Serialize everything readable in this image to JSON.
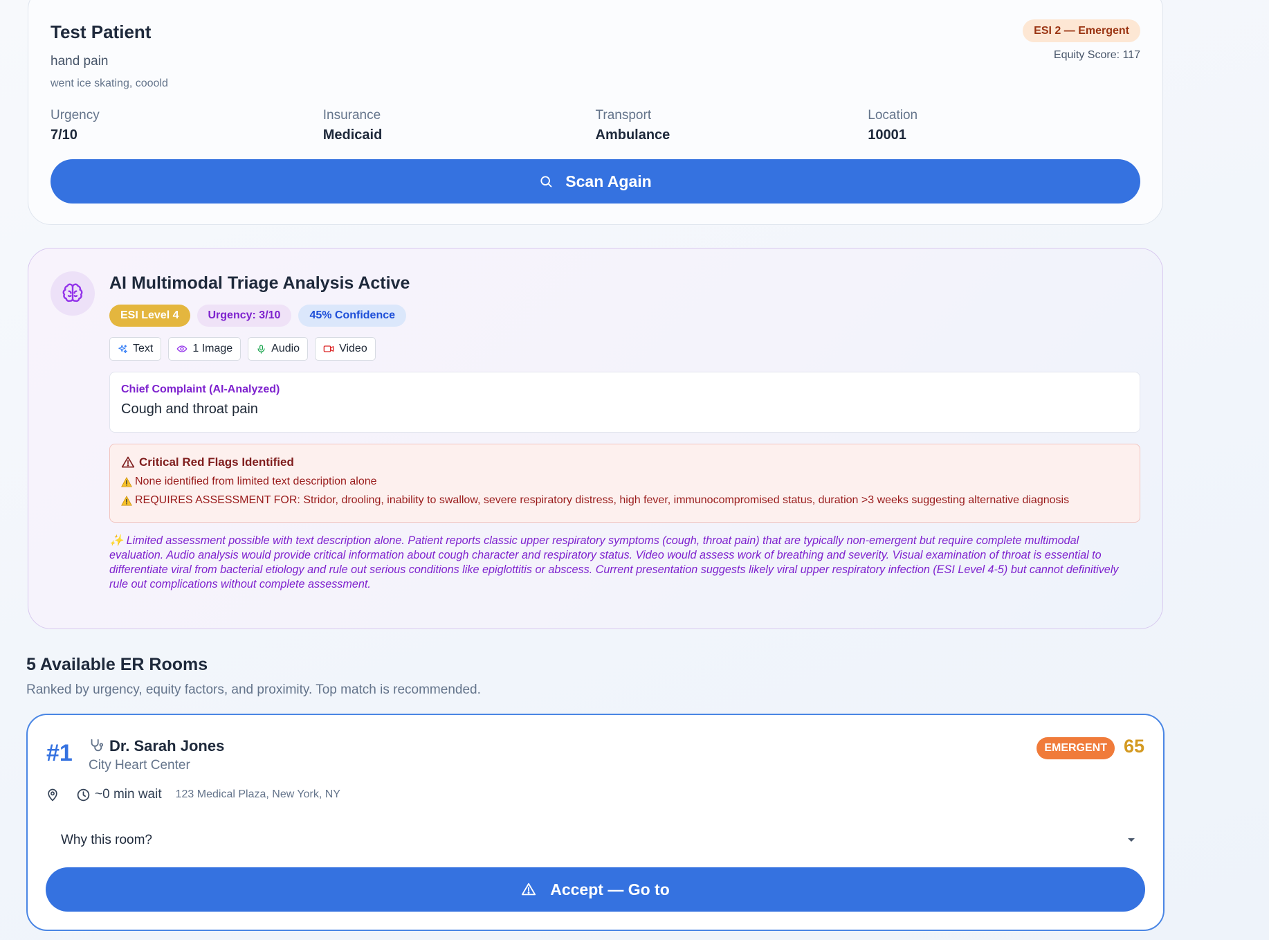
{
  "patient": {
    "name": "Test Patient",
    "complaint": "hand pain",
    "note": "went ice skating, cooold",
    "esi_badge": "ESI 2 — Emergent",
    "equity_score": "Equity Score: 117",
    "fields": [
      {
        "label": "Urgency",
        "value": "7/10"
      },
      {
        "label": "Insurance",
        "value": "Medicaid"
      },
      {
        "label": "Transport",
        "value": "Ambulance"
      },
      {
        "label": "Location",
        "value": "10001"
      }
    ],
    "scan_button": "Scan Again"
  },
  "ai": {
    "title": "AI Multimodal Triage Analysis Active",
    "badges": {
      "esi": "ESI Level 4",
      "urgency": "Urgency: 3/10",
      "confidence": "45% Confidence"
    },
    "modalities": [
      "Text",
      "1 Image",
      "Audio",
      "Video"
    ],
    "chief_complaint_label": "Chief Complaint (AI-Analyzed)",
    "chief_complaint": "Cough and throat pain",
    "red_flags_title": "Critical Red Flags Identified",
    "red_flags": [
      "None identified from limited text description alone",
      "REQUIRES ASSESSMENT FOR: Stridor, drooling, inability to swallow, severe respiratory distress, high fever, immunocompromised status, duration >3 weeks suggesting alternative diagnosis"
    ],
    "summary": "✨ Limited assessment possible with text description alone. Patient reports classic upper respiratory symptoms (cough, throat pain) that are typically non-emergent but require complete multimodal evaluation. Audio analysis would provide critical information about cough character and respiratory status. Video would assess work of breathing and severity. Visual examination of throat is essential to differentiate viral from bacterial etiology and rule out serious conditions like epiglottitis or abscess. Current presentation suggests likely viral upper respiratory infection (ESI Level 4-5) but cannot definitively rule out complications without complete assessment."
  },
  "rooms": {
    "title": "5 Available ER Rooms",
    "subtitle": "Ranked by urgency, equity factors, and proximity. Top match is recommended.",
    "items": [
      {
        "rank": "#1",
        "doctor": "Dr. Sarah Jones",
        "center": "City Heart Center",
        "level": "EMERGENT",
        "score": "65",
        "wait": "~0 min wait",
        "address": "123 Medical Plaza, New York, NY",
        "why_label": "Why this room?",
        "accept_label": "Accept — Go to"
      }
    ]
  },
  "colors": {
    "primary": "#3572e0",
    "purple": "#7e22ce",
    "esi_amber": "#e4b63e",
    "emergent_orange": "#f07b3a",
    "score_gold": "#d49a22",
    "danger": "#991b1b"
  },
  "icons": [
    "search-icon",
    "brain-icon",
    "sparkles-icon",
    "eye-icon",
    "mic-icon",
    "video-icon",
    "alert-triangle-icon",
    "warning-emoji-icon",
    "stethoscope-icon",
    "map-pin-icon",
    "clock-icon",
    "chevron-down-icon"
  ]
}
